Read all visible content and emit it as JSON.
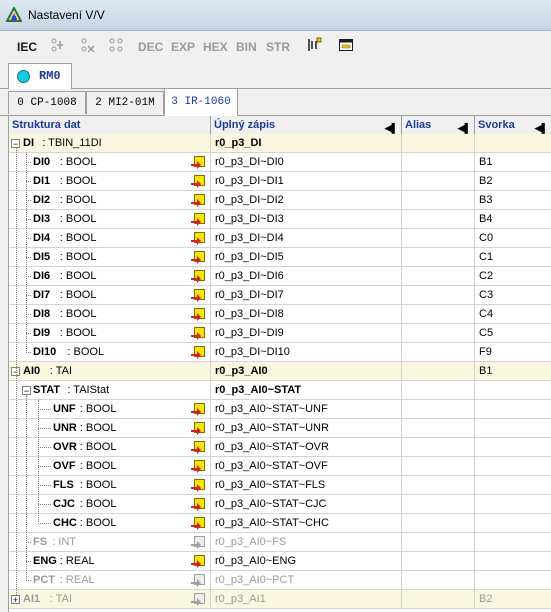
{
  "window": {
    "title": "Nastavení V/V"
  },
  "toolbar": {
    "iec": "IEC",
    "dec": "DEC",
    "exp": "EXP",
    "hex": "HEX",
    "bin": "BIN",
    "str": "STR"
  },
  "module_tab": {
    "label": "RM0",
    "dot_color": "#0ccfe6"
  },
  "subtabs": [
    "0 CP-1008",
    "2 MI2-01M",
    "3 IR-1060"
  ],
  "columns": [
    "Struktura dat",
    "Úplný zápis",
    "Alias",
    "Svorka"
  ],
  "colors": {
    "header_text": "#1b3a9c",
    "selected_row": "#f9f7e0",
    "disabled_text": "#9a9a9a"
  },
  "rows": [
    {
      "name": "DI",
      "type": ": TBIN_11DI",
      "full": "r0_p3_DI",
      "svorka": "",
      "level": 0
    },
    {
      "name": "DI0",
      "type": ": BOOL",
      "full": "r0_p3_DI~DI0",
      "svorka": "B1",
      "level": 1
    },
    {
      "name": "DI1",
      "type": ": BOOL",
      "full": "r0_p3_DI~DI1",
      "svorka": "B2",
      "level": 1
    },
    {
      "name": "DI2",
      "type": ": BOOL",
      "full": "r0_p3_DI~DI2",
      "svorka": "B3",
      "level": 1
    },
    {
      "name": "DI3",
      "type": ": BOOL",
      "full": "r0_p3_DI~DI3",
      "svorka": "B4",
      "level": 1
    },
    {
      "name": "DI4",
      "type": ": BOOL",
      "full": "r0_p3_DI~DI4",
      "svorka": "C0",
      "level": 1
    },
    {
      "name": "DI5",
      "type": ": BOOL",
      "full": "r0_p3_DI~DI5",
      "svorka": "C1",
      "level": 1
    },
    {
      "name": "DI6",
      "type": ": BOOL",
      "full": "r0_p3_DI~DI6",
      "svorka": "C2",
      "level": 1
    },
    {
      "name": "DI7",
      "type": ": BOOL",
      "full": "r0_p3_DI~DI7",
      "svorka": "C3",
      "level": 1
    },
    {
      "name": "DI8",
      "type": ": BOOL",
      "full": "r0_p3_DI~DI8",
      "svorka": "C4",
      "level": 1
    },
    {
      "name": "DI9",
      "type": ": BOOL",
      "full": "r0_p3_DI~DI9",
      "svorka": "C5",
      "level": 1
    },
    {
      "name": "DI10",
      "type": ": BOOL",
      "full": "r0_p3_DI~DI10",
      "svorka": "F9",
      "level": 1
    },
    {
      "name": "AI0",
      "type": ": TAI",
      "full": "r0_p3_AI0",
      "svorka": "B1",
      "level": 0
    },
    {
      "name": "STAT",
      "type": ": TAIStat",
      "full": "r0_p3_AI0~STAT",
      "svorka": "",
      "level": 1
    },
    {
      "name": "UNF",
      "type": ": BOOL",
      "full": "r0_p3_AI0~STAT~UNF",
      "svorka": "",
      "level": 2
    },
    {
      "name": "UNR",
      "type": ": BOOL",
      "full": "r0_p3_AI0~STAT~UNR",
      "svorka": "",
      "level": 2
    },
    {
      "name": "OVR",
      "type": ": BOOL",
      "full": "r0_p3_AI0~STAT~OVR",
      "svorka": "",
      "level": 2
    },
    {
      "name": "OVF",
      "type": ": BOOL",
      "full": "r0_p3_AI0~STAT~OVF",
      "svorka": "",
      "level": 2
    },
    {
      "name": "FLS",
      "type": ": BOOL",
      "full": "r0_p3_AI0~STAT~FLS",
      "svorka": "",
      "level": 2
    },
    {
      "name": "CJC",
      "type": ": BOOL",
      "full": "r0_p3_AI0~STAT~CJC",
      "svorka": "",
      "level": 2
    },
    {
      "name": "CHC",
      "type": ": BOOL",
      "full": "r0_p3_AI0~STAT~CHC",
      "svorka": "",
      "level": 2
    },
    {
      "name": "FS",
      "type": ": INT",
      "full": "r0_p3_AI0~FS",
      "svorka": "",
      "level": 1
    },
    {
      "name": "ENG",
      "type": ": REAL",
      "full": "r0_p3_AI0~ENG",
      "svorka": "",
      "level": 1
    },
    {
      "name": "PCT",
      "type": ": REAL",
      "full": "r0_p3_AI0~PCT",
      "svorka": "",
      "level": 1
    },
    {
      "name": "AI1",
      "type": ": TAI",
      "full": "r0_p3_AI1",
      "svorka": "B2",
      "level": 0
    }
  ]
}
